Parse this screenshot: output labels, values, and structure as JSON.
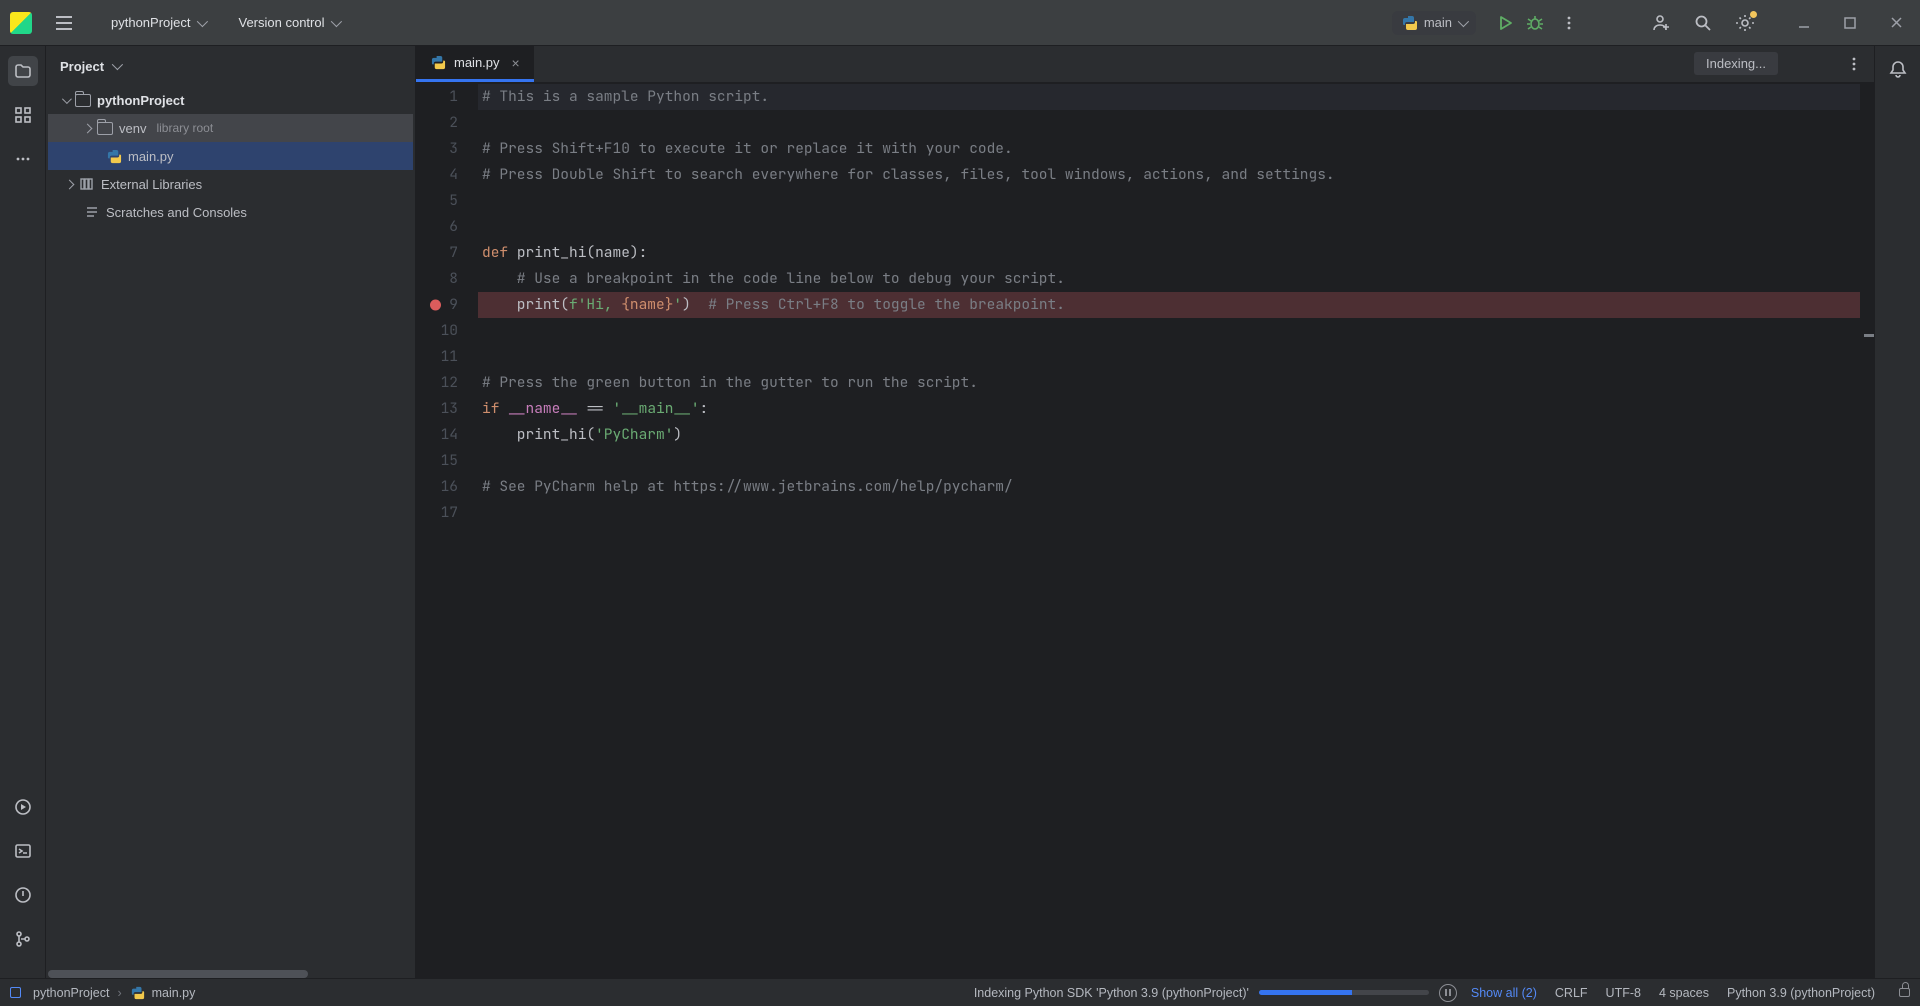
{
  "titlebar": {
    "project_name": "pythonProject",
    "vcs_label": "Version control",
    "run_config": "main"
  },
  "project_panel": {
    "title": "Project",
    "root": "pythonProject",
    "venv": "venv",
    "venv_annot": "library root",
    "file": "main.py",
    "ext_libs": "External Libraries",
    "scratches": "Scratches and Consoles"
  },
  "editor": {
    "tab_label": "main.py",
    "indexing_chip": "Indexing...",
    "lines": [
      "1",
      "2",
      "3",
      "4",
      "5",
      "6",
      "7",
      "8",
      "9",
      "10",
      "11",
      "12",
      "13",
      "14",
      "15",
      "16",
      "17"
    ],
    "breakpoint_line": 9,
    "code": {
      "l1": "# This is a sample Python script.",
      "l3": "# Press Shift+F10 to execute it or replace it with your code.",
      "l4": "# Press Double Shift to search everywhere for classes, files, tool windows, actions, and settings.",
      "l7_kw": "def ",
      "l7_rest": "print_hi(name):",
      "l8": "    # Use a breakpoint in the code line below to debug your script.",
      "l9_a": "    print(",
      "l9_b": "f'Hi, ",
      "l9_c": "{name}",
      "l9_d": "'",
      "l9_e": ")  ",
      "l9_f": "# Press Ctrl+F8 to toggle the breakpoint.",
      "l12": "# Press the green button in the gutter to run the script.",
      "l13_kw": "if ",
      "l13_a": "__name__ ",
      "l13_b": "== ",
      "l13_c": "'__main__'",
      "l13_d": ":",
      "l14_a": "    print_hi(",
      "l14_b": "'PyCharm'",
      "l14_c": ")",
      "l16": "# See PyCharm help at https://www.jetbrains.com/help/pycharm/"
    }
  },
  "status": {
    "bc_project": "pythonProject",
    "bc_file": "main.py",
    "indexing_text": "Indexing Python SDK 'Python 3.9 (pythonProject)'",
    "show_all": "Show all (2)",
    "line_sep": "CRLF",
    "encoding": "UTF-8",
    "indent": "4 spaces",
    "interpreter": "Python 3.9 (pythonProject)"
  }
}
